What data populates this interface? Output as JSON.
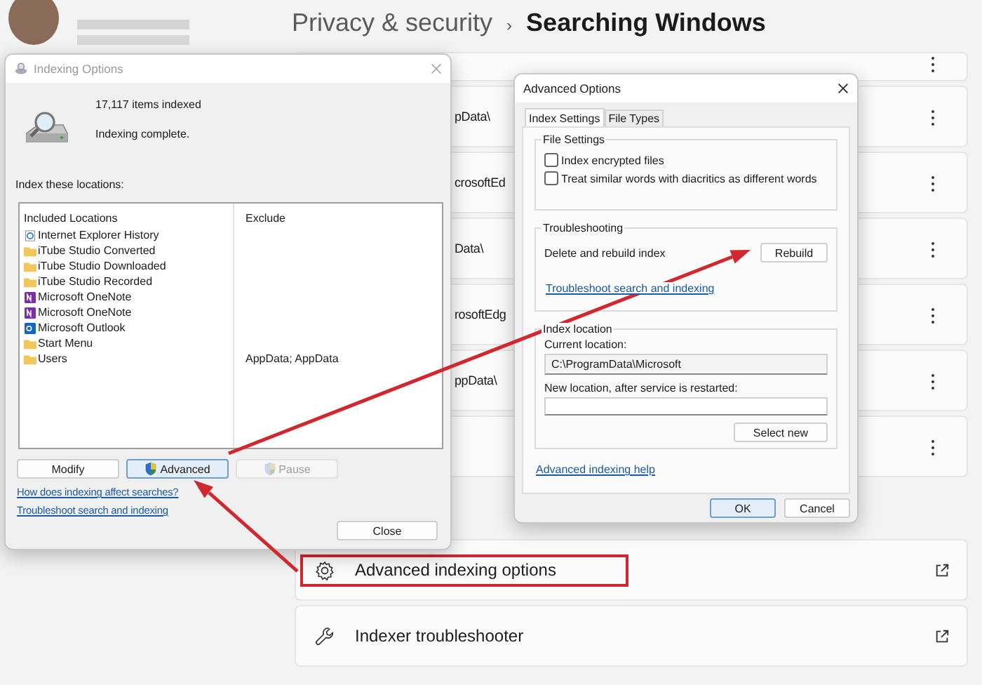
{
  "header": {
    "parent": "Privacy & security",
    "separator": "›",
    "title": "Searching Windows"
  },
  "location_rows": [
    {
      "kind": "more"
    },
    {
      "kind": "more",
      "text": "pData\\"
    },
    {
      "kind": "more",
      "text": "crosoftEd"
    },
    {
      "kind": "more",
      "text": "Data\\"
    },
    {
      "kind": "more",
      "text": "rosoftEdg"
    },
    {
      "kind": "more",
      "text": "ppData\\"
    },
    {
      "kind": "more"
    }
  ],
  "links": [
    {
      "kind": "gear",
      "label": "Advanced indexing options",
      "highlighted": true
    },
    {
      "kind": "wrench",
      "label": "Indexer troubleshooter",
      "highlighted": false
    }
  ],
  "indexing_options": {
    "title": "Indexing Options",
    "count": "17,117 items indexed",
    "status": "Indexing complete.",
    "locations_label": "Index these locations:",
    "columns": [
      "Included Locations",
      "Exclude"
    ],
    "rows": [
      {
        "kind": "ie",
        "name": "Internet Explorer History"
      },
      {
        "kind": "folder",
        "name": "iTube Studio Converted"
      },
      {
        "kind": "folder",
        "name": "iTube Studio Downloaded"
      },
      {
        "kind": "folder",
        "name": "iTube Studio Recorded"
      },
      {
        "kind": "onenote",
        "name": "Microsoft OneNote"
      },
      {
        "kind": "onenote",
        "name": "Microsoft OneNote"
      },
      {
        "kind": "outlook",
        "name": "Microsoft Outlook"
      },
      {
        "kind": "folder",
        "name": "Start Menu"
      },
      {
        "kind": "folder",
        "name": "Users",
        "exclude": "AppData; AppData"
      }
    ],
    "buttons": [
      {
        "label": "Modify",
        "shield": false,
        "focused": false,
        "disabled": false
      },
      {
        "label": "Advanced",
        "shield": true,
        "focused": true,
        "disabled": false
      },
      {
        "label": "Pause",
        "shield": true,
        "focused": false,
        "disabled": true
      }
    ],
    "links": [
      "How does indexing affect searches?",
      "Troubleshoot search and indexing"
    ],
    "close": "Close"
  },
  "advanced_options": {
    "title": "Advanced Options",
    "tabs": [
      {
        "label": "Index Settings",
        "selected": true
      },
      {
        "label": "File Types",
        "selected": false
      }
    ],
    "file_settings": {
      "title": "File Settings",
      "checkboxes": [
        {
          "label": "Index encrypted files",
          "checked": false
        },
        {
          "label": "Treat similar words with diacritics as different words",
          "checked": false
        }
      ]
    },
    "troubleshooting": {
      "title": "Troubleshooting",
      "text": "Delete and rebuild index",
      "button": "Rebuild",
      "link": "Troubleshoot search and indexing"
    },
    "index_location": {
      "title": "Index location",
      "current_label": "Current location:",
      "current_value": "C:\\ProgramData\\Microsoft",
      "new_label": "New location, after service is restarted:",
      "button": "Select new"
    },
    "help_link": "Advanced indexing help",
    "buttons": [
      {
        "label": "OK",
        "focused": true
      },
      {
        "label": "Cancel",
        "focused": false
      }
    ]
  }
}
